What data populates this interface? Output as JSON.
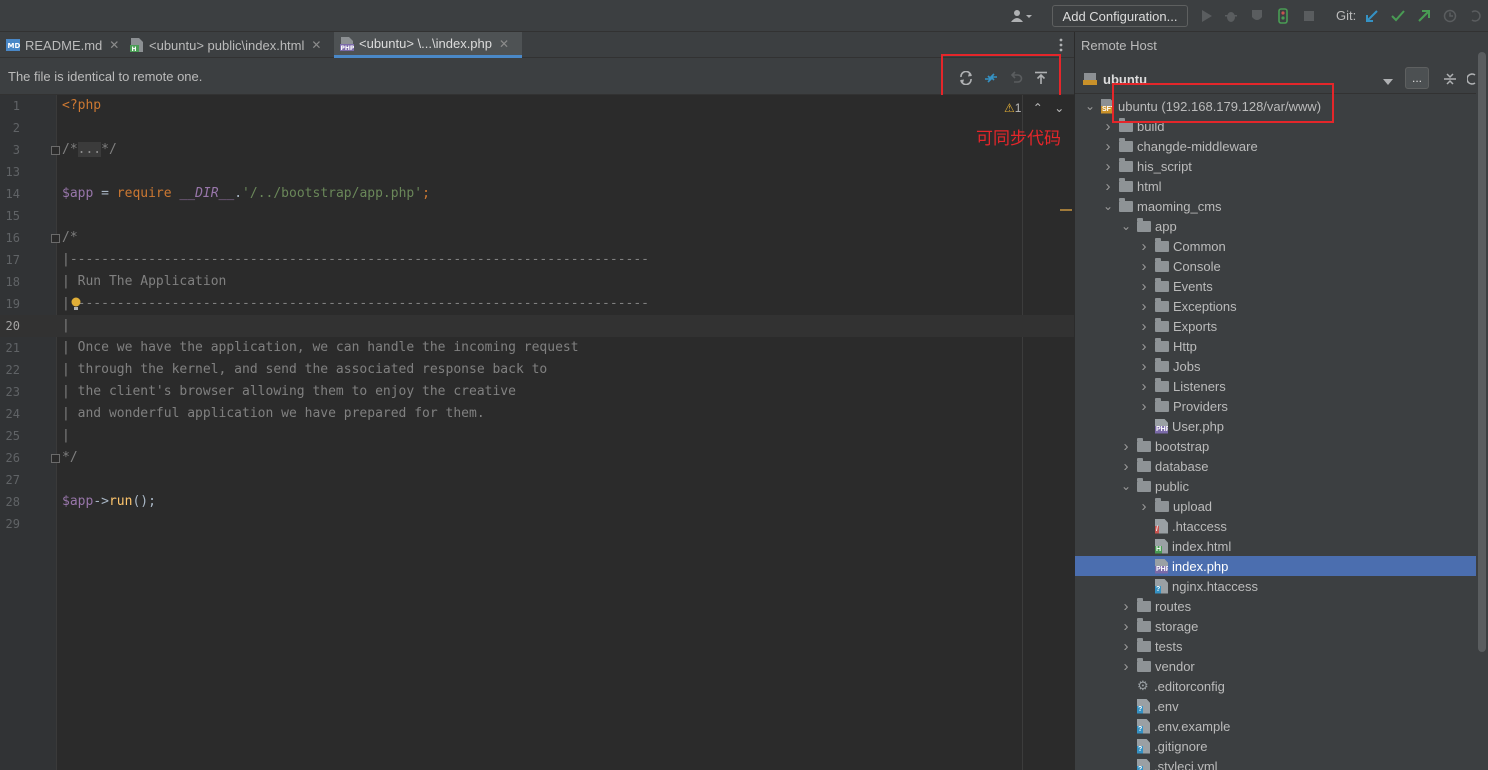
{
  "toolbar": {
    "add_config_label": "Add Configuration...",
    "git_label": "Git:"
  },
  "tabs": [
    {
      "icon": "md",
      "label": "README.md"
    },
    {
      "icon": "html",
      "label": "<ubuntu> public\\index.html"
    },
    {
      "icon": "php",
      "label": "<ubuntu> \\...\\index.php"
    }
  ],
  "notification": {
    "message": "The file is identical to remote one."
  },
  "editor": {
    "warning_count": "1",
    "lines": [
      {
        "n": "1"
      },
      {
        "n": "2"
      },
      {
        "n": "3"
      },
      {
        "n": "13"
      },
      {
        "n": "14"
      },
      {
        "n": "15"
      },
      {
        "n": "16"
      },
      {
        "n": "17"
      },
      {
        "n": "18"
      },
      {
        "n": "19"
      },
      {
        "n": "20"
      },
      {
        "n": "21"
      },
      {
        "n": "22"
      },
      {
        "n": "23"
      },
      {
        "n": "24"
      },
      {
        "n": "25"
      },
      {
        "n": "26"
      },
      {
        "n": "27"
      },
      {
        "n": "28"
      },
      {
        "n": "29"
      }
    ],
    "code": {
      "php_open": "<?php",
      "fold_start": "/*",
      "fold_dots": "...",
      "fold_end": "*/",
      "app_var": "$app",
      "assign": " = ",
      "require_kw": "require",
      "dir_const": "__DIR__",
      "concat": ".",
      "path_str": "'/../bootstrap/app.php'",
      "semi": ";",
      "c16": "/*",
      "c17": "|--------------------------------------------------------------------------",
      "c18": "| Run The Application",
      "c19": "|--------------------------------------------------------------------------",
      "c20": "|",
      "c21": "| Once we have the application, we can handle the incoming request",
      "c22": "| through the kernel, and send the associated response back to",
      "c23": "| the client's browser allowing them to enjoy the creative",
      "c24": "| and wonderful application we have prepared for them.",
      "c25": "|",
      "c26": "*/",
      "arrow": "->",
      "run_fn": "run",
      "run_tail": "();"
    }
  },
  "annotation": "可同步代码",
  "remote_panel": {
    "title": "Remote Host",
    "host": "ubuntu",
    "more_label": "...",
    "tree": [
      {
        "depth": 0,
        "type": "root",
        "label": "ubuntu (192.168.179.128/var/www)",
        "expanded": true
      },
      {
        "depth": 1,
        "type": "folder",
        "label": "build",
        "expanded": false
      },
      {
        "depth": 1,
        "type": "folder",
        "label": "changde-middleware",
        "expanded": false
      },
      {
        "depth": 1,
        "type": "folder",
        "label": "his_script",
        "expanded": false
      },
      {
        "depth": 1,
        "type": "folder",
        "label": "html",
        "expanded": false
      },
      {
        "depth": 1,
        "type": "folder",
        "label": "maoming_cms",
        "expanded": true
      },
      {
        "depth": 2,
        "type": "folder",
        "label": "app",
        "expanded": true
      },
      {
        "depth": 3,
        "type": "folder",
        "label": "Common",
        "expanded": false
      },
      {
        "depth": 3,
        "type": "folder",
        "label": "Console",
        "expanded": false
      },
      {
        "depth": 3,
        "type": "folder",
        "label": "Events",
        "expanded": false
      },
      {
        "depth": 3,
        "type": "folder",
        "label": "Exceptions",
        "expanded": false
      },
      {
        "depth": 3,
        "type": "folder",
        "label": "Exports",
        "expanded": false
      },
      {
        "depth": 3,
        "type": "folder",
        "label": "Http",
        "expanded": false
      },
      {
        "depth": 3,
        "type": "folder",
        "label": "Jobs",
        "expanded": false
      },
      {
        "depth": 3,
        "type": "folder",
        "label": "Listeners",
        "expanded": false
      },
      {
        "depth": 3,
        "type": "folder",
        "label": "Providers",
        "expanded": false
      },
      {
        "depth": 3,
        "type": "php",
        "label": "User.php"
      },
      {
        "depth": 2,
        "type": "folder",
        "label": "bootstrap",
        "expanded": false
      },
      {
        "depth": 2,
        "type": "folder",
        "label": "database",
        "expanded": false
      },
      {
        "depth": 2,
        "type": "folder",
        "label": "public",
        "expanded": true
      },
      {
        "depth": 3,
        "type": "folder",
        "label": "upload",
        "expanded": false
      },
      {
        "depth": 3,
        "type": "htaccess",
        "label": ".htaccess"
      },
      {
        "depth": 3,
        "type": "html",
        "label": "index.html"
      },
      {
        "depth": 3,
        "type": "php",
        "label": "index.php",
        "selected": true
      },
      {
        "depth": 3,
        "type": "config",
        "label": "nginx.htaccess"
      },
      {
        "depth": 2,
        "type": "folder",
        "label": "routes",
        "expanded": false
      },
      {
        "depth": 2,
        "type": "folder",
        "label": "storage",
        "expanded": false
      },
      {
        "depth": 2,
        "type": "folder",
        "label": "tests",
        "expanded": false
      },
      {
        "depth": 2,
        "type": "folder",
        "label": "vendor",
        "expanded": false
      },
      {
        "depth": 2,
        "type": "gear",
        "label": ".editorconfig"
      },
      {
        "depth": 2,
        "type": "config",
        "label": ".env"
      },
      {
        "depth": 2,
        "type": "config",
        "label": ".env.example"
      },
      {
        "depth": 2,
        "type": "config",
        "label": ".gitignore"
      },
      {
        "depth": 2,
        "type": "config",
        "label": ".styleci.yml"
      }
    ]
  },
  "colors": {
    "accent_red": "#e5262a",
    "selection": "#4b6eaf",
    "git_blue": "#3592c4",
    "git_green": "#499c54"
  }
}
